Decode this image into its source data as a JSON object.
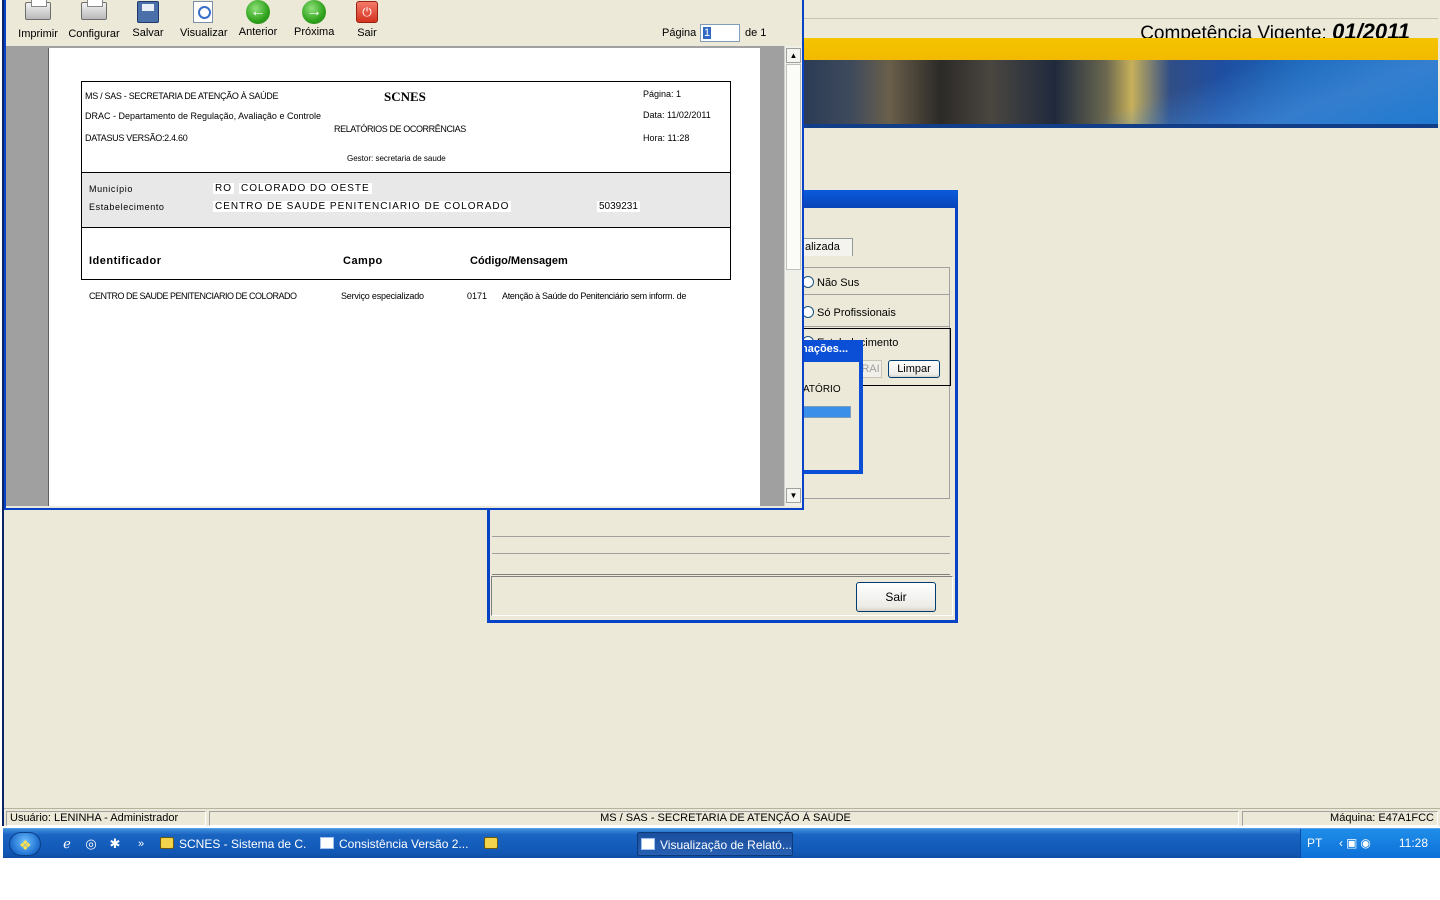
{
  "header": {
    "competencia_label": "Competência Vigente:",
    "competencia_value": "01/2011"
  },
  "viewer": {
    "toolbar": [
      {
        "label": "Imprimir",
        "icon": "printer-icon"
      },
      {
        "label": "Configurar",
        "icon": "printer-settings-icon"
      },
      {
        "label": "Salvar",
        "icon": "save-icon"
      },
      {
        "label": "Visualizar",
        "icon": "preview-icon"
      },
      {
        "label": "Anterior",
        "icon": "arrow-left-icon"
      },
      {
        "label": "Próxima",
        "icon": "arrow-right-icon"
      },
      {
        "label": "Sair",
        "icon": "exit-icon"
      }
    ],
    "page_label": "Página",
    "page_value": "1",
    "page_of": "de 1"
  },
  "report": {
    "org": "MS / SAS - SECRETARIA DE ATENÇÃO À SAÚDE",
    "system": "SCNES",
    "dept": "DRAC - Departamento de Regulação, Avaliação e Controle",
    "version": "DATASUS VERSÃO:2.4.60",
    "title": "RELATÓRIOS DE OCORRÊNCIAS",
    "gestor": "Gestor: secretaria de saude",
    "page": "Página: 1",
    "date": "Data: 11/02/2011",
    "time": "Hora: 11:28",
    "municipio_label": "Município",
    "municipio_uf": "RO",
    "municipio_name": "COLORADO DO OESTE",
    "estab_label": "Estabelecimento",
    "estab_name": "CENTRO DE SAUDE PENITENCIARIO DE COLORADO",
    "estab_code": "5039231",
    "col_identificador": "Identificador",
    "col_campo": "Campo",
    "col_codigo": "Código/Mensagem",
    "rows": [
      {
        "identificador": "CENTRO DE SAUDE PENITENCIARIO DE COLORADO",
        "campo": "Serviço especializado",
        "codigo": "0171",
        "mensagem": "Atenção à Saúde do Penitenciário sem inform. de"
      }
    ]
  },
  "consistencia": {
    "tab_partial": "alizada",
    "radio_nao_sus": "Não Sus",
    "radio_so_profissionais": "Só Profissionais",
    "radio_estabelecimento": "Estabelecimento",
    "btn_partial": "RAI",
    "btn_limpar": "Limpar",
    "btn_sair": "Sair"
  },
  "info_dialog": {
    "title": "nações...",
    "text": "ATÓRIO",
    "progress": 1.0
  },
  "status_bar": {
    "user": "Usuário: LENINHA - Administrador",
    "org": "MS / SAS - SECRETARIA DE ATENÇÃO À SAÚDE",
    "machine": "Máquina: E47A1FCC"
  },
  "taskbar": {
    "buttons": [
      {
        "label": "SCNES - Sistema de C...",
        "active": false
      },
      {
        "label": "Consistência Versão 2...",
        "active": false
      },
      {
        "label": "Visualização de Relató...",
        "active": true
      }
    ],
    "language": "PT",
    "clock": "11:28"
  }
}
